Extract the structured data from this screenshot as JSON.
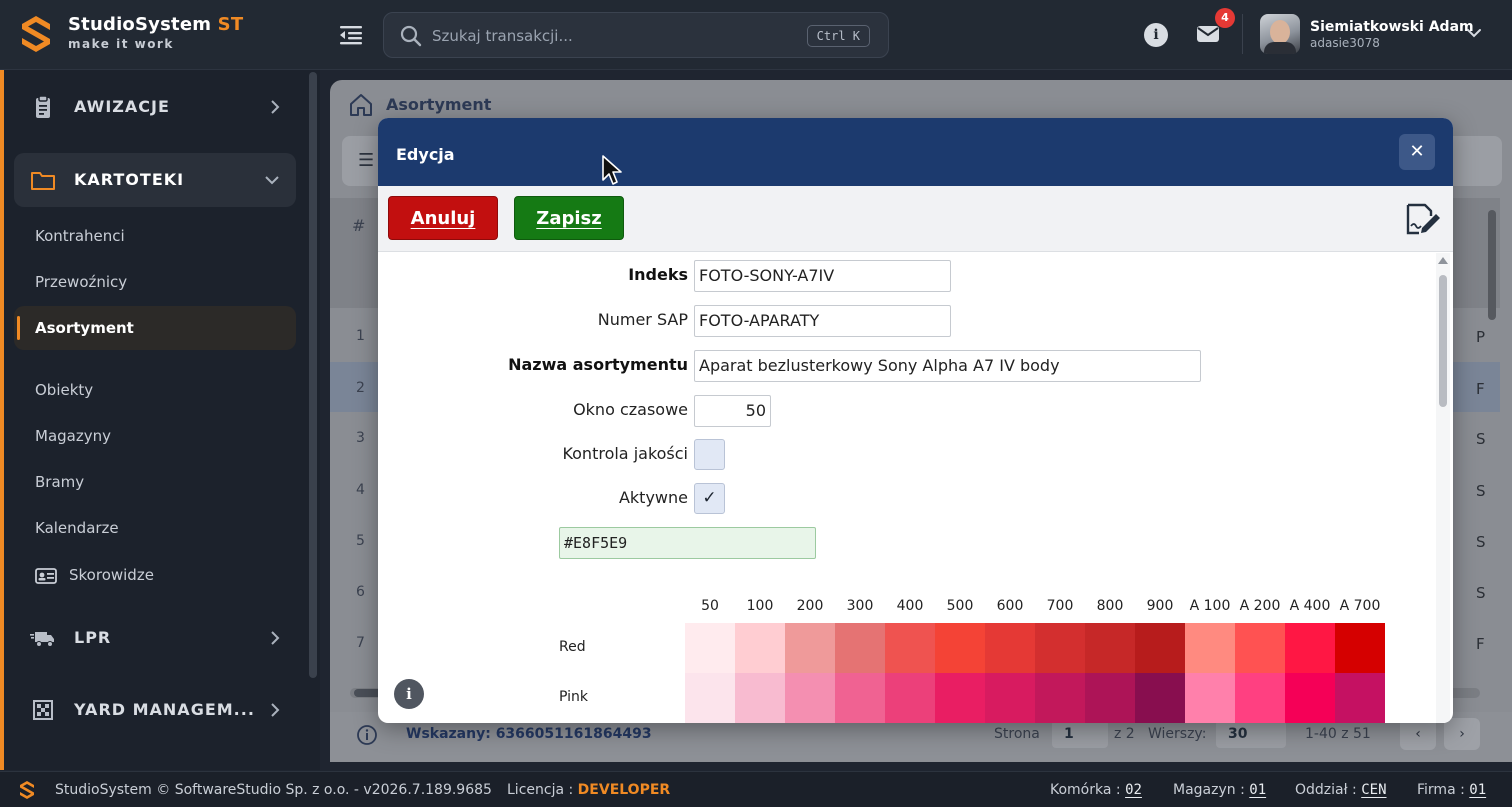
{
  "app": {
    "name": "StudioSystem",
    "name_suffix": "ST",
    "tagline": "make it work"
  },
  "search": {
    "placeholder": "Szukaj transakcji...",
    "shortcut": "Ctrl K"
  },
  "notifications": {
    "count": "4"
  },
  "user": {
    "name": "Siemiatkowski Adam",
    "login": "adasie3078"
  },
  "sidebar": {
    "groups": [
      {
        "label": "AWIZACJE",
        "icon": "clipboard-icon"
      },
      {
        "label": "KARTOTEKI",
        "icon": "folder-icon",
        "expanded": true
      },
      {
        "label": "LPR",
        "icon": "truck-icon"
      },
      {
        "label": "YARD MANAGEM...",
        "icon": "grid-icon"
      }
    ],
    "items": [
      {
        "label": "Kontrahenci"
      },
      {
        "label": "Przewoźnicy"
      },
      {
        "label": "Asortyment",
        "active": true
      },
      {
        "label": "Obiekty"
      },
      {
        "label": "Magazyny"
      },
      {
        "label": "Bramy"
      },
      {
        "label": "Kalendarze"
      },
      {
        "label": "Skorowidze",
        "icon": "id-card-icon"
      }
    ]
  },
  "page": {
    "breadcrumb": "Asortyment",
    "header_hash": "#",
    "rows": [
      "1",
      "2",
      "3",
      "4",
      "5",
      "6",
      "7"
    ],
    "row_letters": [
      "P",
      "F",
      "S",
      "S",
      "S",
      "S",
      "F"
    ],
    "footer": {
      "selected": "Wskazany: 6366051161864493",
      "page_label": "Strona",
      "page_value": "1",
      "page_of": "z 2",
      "rows_label": "Wierszy:",
      "rows_value": "30",
      "range": "1-40 z 51"
    }
  },
  "modal": {
    "title": "Edycja",
    "cancel_label": "Anuluj",
    "save_label": "Zapisz",
    "fields": {
      "indeks_label": "Indeks",
      "indeks_value": "FOTO-SONY-A7IV",
      "sap_label": "Numer SAP",
      "sap_value": "FOTO-APARATY",
      "nazwa_label": "Nazwa asortymentu",
      "nazwa_value": "Aparat bezlusterkowy Sony Alpha A7 IV body",
      "okno_label": "Okno czasowe",
      "okno_value": "50",
      "kontrola_label": "Kontrola jakości",
      "kontrola_checked": false,
      "aktywne_label": "Aktywne",
      "aktywne_checked": true,
      "aktywne_mark": "✓",
      "color_value": "#E8F5E9"
    },
    "palette": {
      "shades": [
        "50",
        "100",
        "200",
        "300",
        "400",
        "500",
        "600",
        "700",
        "800",
        "900",
        "A 100",
        "A 200",
        "A 400",
        "A 700"
      ],
      "rows": [
        {
          "name": "Red",
          "colors": [
            "#FFEBEE",
            "#FFCDD2",
            "#EF9A9A",
            "#E57373",
            "#EF5350",
            "#F44336",
            "#E53935",
            "#D32F2F",
            "#C62828",
            "#B71C1C",
            "#FF8A80",
            "#FF5252",
            "#FF1744",
            "#D50000"
          ]
        },
        {
          "name": "Pink",
          "colors": [
            "#FCE4EC",
            "#F8BBD0",
            "#F48FB1",
            "#F06292",
            "#EC407A",
            "#E91E63",
            "#D81B60",
            "#C2185B",
            "#AD1457",
            "#880E4F",
            "#FF80AB",
            "#FF4081",
            "#F50057",
            "#C51162"
          ]
        }
      ]
    }
  },
  "statusbar": {
    "copyright": "StudioSystem © SoftwareStudio Sp. z o.o. - v2026.7.189.9685",
    "license_label": "Licencja :",
    "license_value": "DEVELOPER",
    "komorka_label": "Komórka :",
    "komorka_value": "02",
    "magazyn_label": "Magazyn :",
    "magazyn_value": "01",
    "oddzial_label": "Oddział :",
    "oddzial_value": "CEN",
    "firma_label": "Firma :",
    "firma_value": "01"
  },
  "colors": {
    "accent": "#f08a24",
    "modal_header": "#1c3a6e",
    "cancel": "#c20f0f",
    "save": "#157a14"
  }
}
